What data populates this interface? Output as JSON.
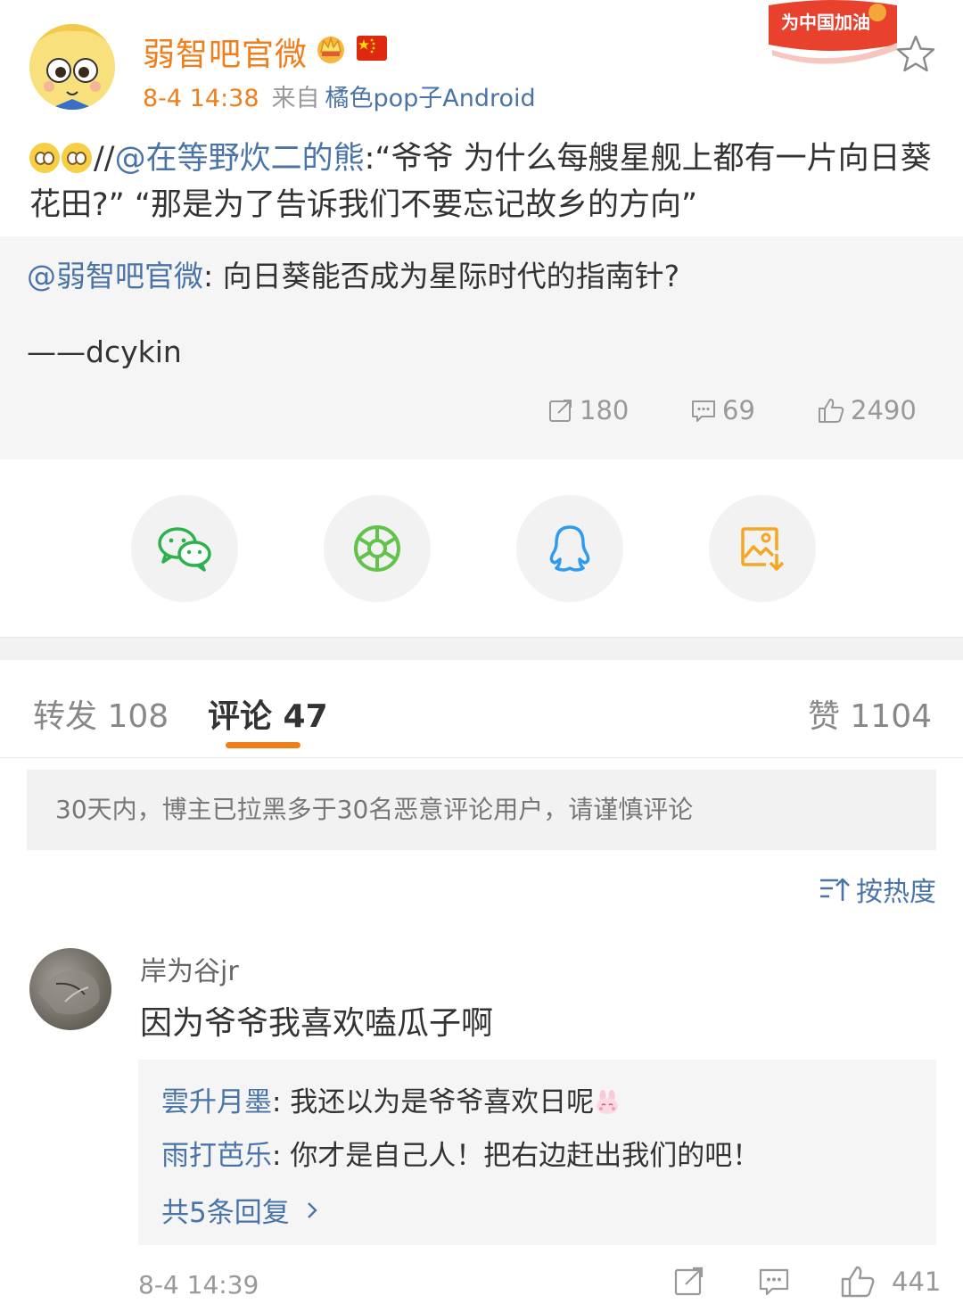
{
  "post": {
    "author": "弱智吧官微",
    "time": "8-4 14:38",
    "from_label": "来自",
    "device": "橘色pop子Android",
    "badge_text": "为中国加油",
    "text_prefix": "//",
    "mention": "@在等野炊二的熊",
    "text_body": ":“爷爷 为什么每艘星舰上都有一片向日葵花田?” “那是为了告诉我们不要忘记故乡的方向”"
  },
  "retweet": {
    "mention": "@弱智吧官微",
    "text": ": 向日葵能否成为星际时代的指南针?",
    "signature": "——dcykin",
    "stats": {
      "reposts": "180",
      "comments": "69",
      "likes": "2490"
    }
  },
  "share": {
    "items": [
      {
        "name": "wechat-icon"
      },
      {
        "name": "moments-icon"
      },
      {
        "name": "qq-icon"
      },
      {
        "name": "save-image-icon"
      }
    ],
    "colors": {
      "wechat": "#2bb24c",
      "moments": "#63c24a",
      "qq": "#2f9bf0",
      "save": "#f5a623"
    }
  },
  "tabs": {
    "repost": "转发 108",
    "comment": "评论 47",
    "like": "赞 1104"
  },
  "notice": "30天内，博主已拉黑多于30名恶意评论用户，请谨慎评论",
  "sort_label": "按热度",
  "comment": {
    "user": "岸为谷jr",
    "text": "因为爷爷我喜欢嗑瓜子啊",
    "replies": [
      {
        "who": "雲升月墨",
        "text": ": 我还以为是爷爷喜欢日呢"
      },
      {
        "who": "雨打芭乐",
        "text": ": 你才是自己人！把右边赶出我们的吧！"
      }
    ],
    "more": "共5条回复",
    "time": "8-4 14:39",
    "likes": "441"
  },
  "colors": {
    "accent": "#f07e1b",
    "link": "#4a74a8"
  }
}
